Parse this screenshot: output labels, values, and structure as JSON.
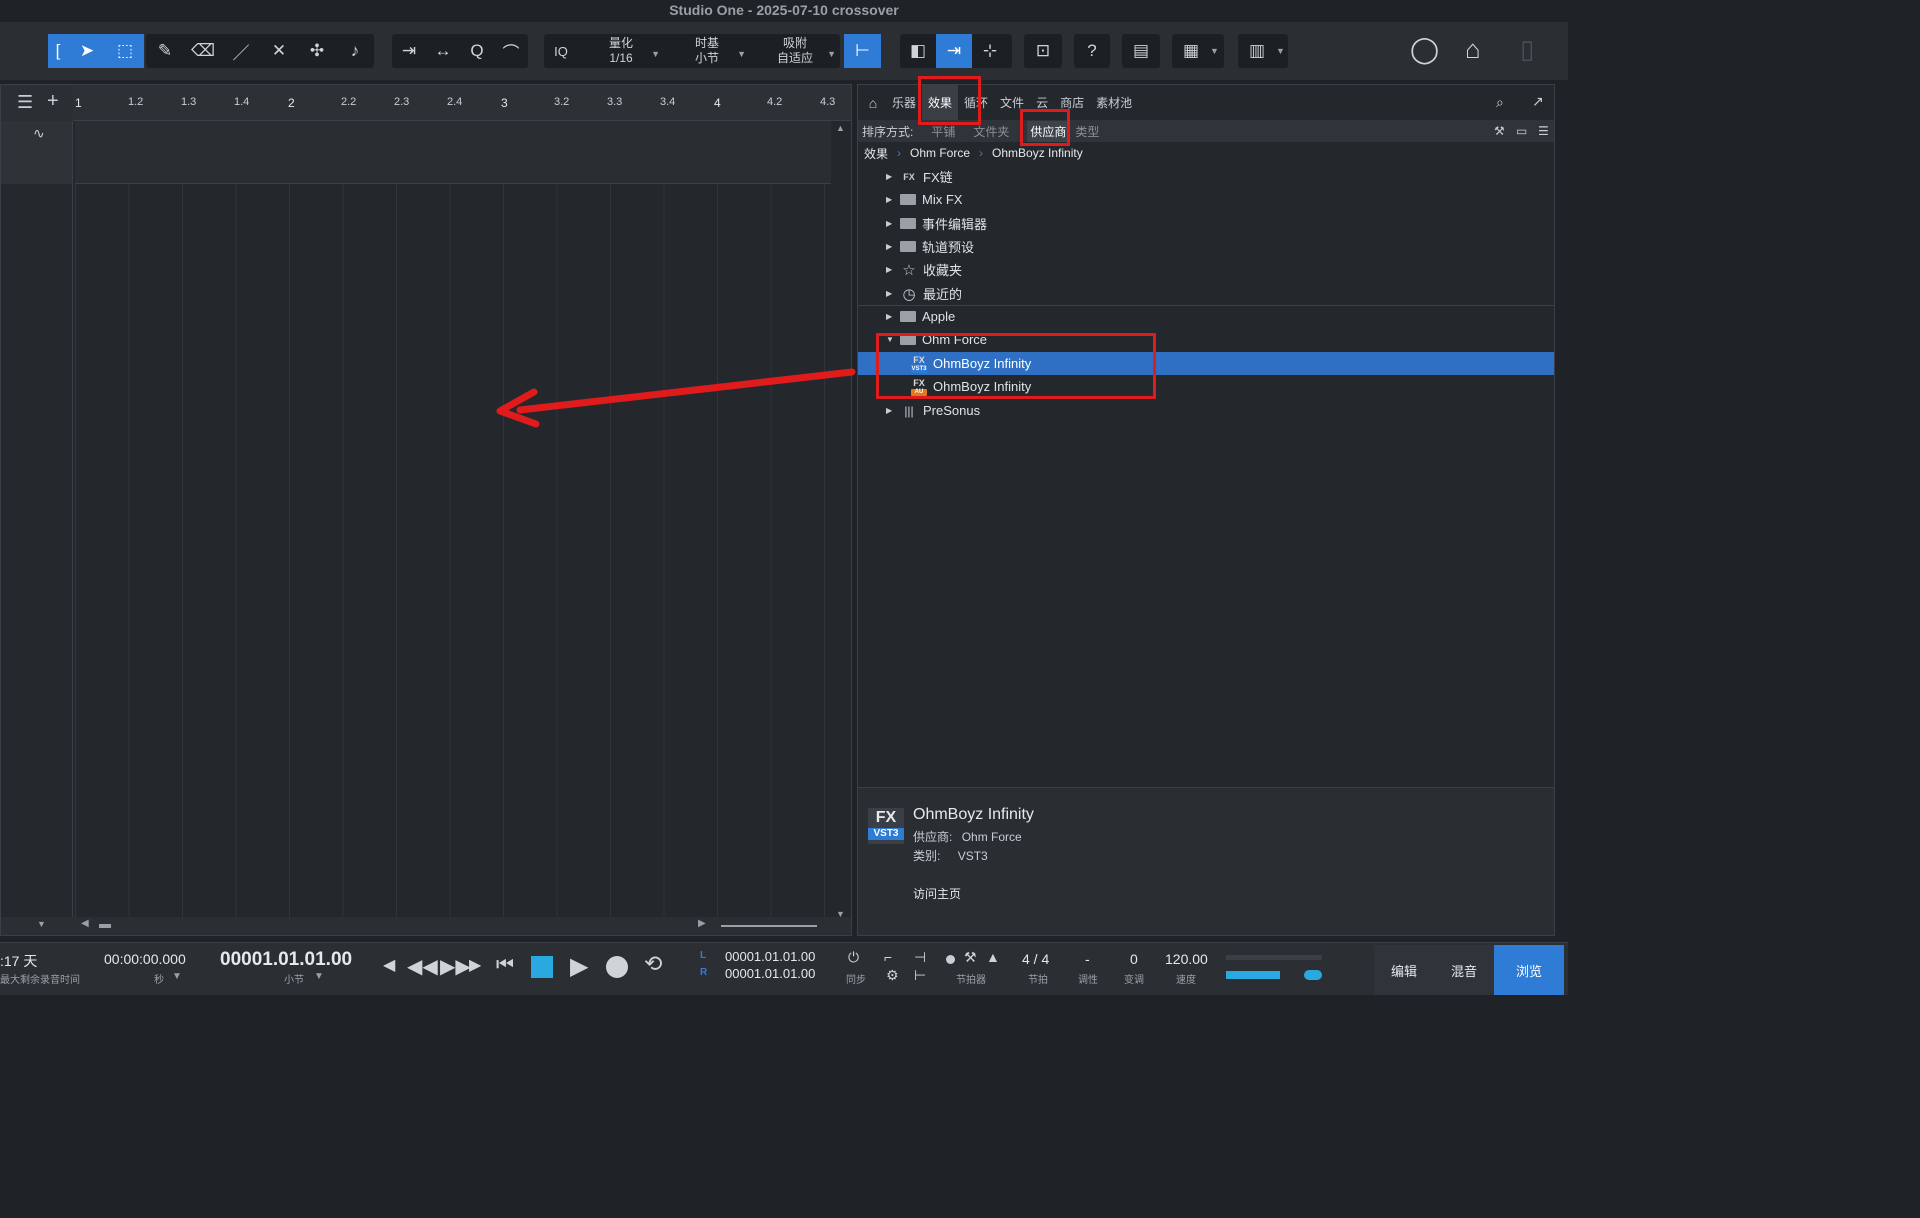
{
  "window": {
    "title": "Studio One - 2025-07-10 crossover"
  },
  "toolbar": {
    "quantize_label": "量化",
    "quantize_value": "1/16",
    "timebase_label": "时基",
    "timebase_value": "小节",
    "snap_label": "吸附",
    "snap_value": "自适应",
    "iq_label": "IQ",
    "help_label": "?"
  },
  "ruler": {
    "ticks": [
      "1",
      "1.2",
      "1.3",
      "1.4",
      "2",
      "2.2",
      "2.3",
      "2.4",
      "3",
      "3.2",
      "3.3",
      "3.4",
      "4",
      "4.2",
      "4.3"
    ]
  },
  "browser": {
    "tabs": [
      "乐器",
      "效果",
      "循环",
      "文件",
      "云",
      "商店",
      "素材池"
    ],
    "active_tab": "效果",
    "sort_label": "排序方式:",
    "sort_options": [
      "平铺",
      "文件夹",
      "供应商",
      "类型"
    ],
    "sort_selected": "供应商",
    "breadcrumb": [
      "效果",
      "Ohm Force",
      "OhmBoyz Infinity"
    ],
    "tree": [
      {
        "label": "FX链",
        "icon": "fx-chain-icon"
      },
      {
        "label": "Mix FX",
        "icon": "mixfx-icon"
      },
      {
        "label": "事件编辑器",
        "icon": "event-editor-icon"
      },
      {
        "label": "轨道预设",
        "icon": "track-preset-icon"
      },
      {
        "label": "收藏夹",
        "icon": "star-icon"
      },
      {
        "label": "最近的",
        "icon": "clock-icon"
      },
      {
        "label": "Apple",
        "icon": "folder-icon"
      },
      {
        "label": "Ohm Force",
        "icon": "folder-open-icon"
      },
      {
        "label": "OhmBoyz Infinity",
        "icon": "fx-vst3-icon",
        "badge": "VST3"
      },
      {
        "label": "OhmBoyz Infinity",
        "icon": "fx-au-icon",
        "badge": "AU"
      },
      {
        "label": "PreSonus",
        "icon": "presonus-icon"
      }
    ],
    "info": {
      "badge_top": "FX",
      "badge_bottom": "VST3",
      "name": "OhmBoyz Infinity",
      "vendor_label": "供应商:",
      "vendor": "Ohm Force",
      "category_label": "类别:",
      "category": "VST3",
      "homepage": "访问主页"
    }
  },
  "transport": {
    "record_time": ":17 天",
    "record_time_label": "最大剩余录音时间",
    "seconds_value": "00:00:00.000",
    "seconds_label": "秒",
    "position_value": "00001.01.01.00",
    "position_label": "小节",
    "loop_l_label": "L",
    "loop_r_label": "R",
    "loop_l": "00001.01.01.00",
    "loop_r": "00001.01.01.00",
    "sync_label": "同步",
    "metronome_label": "节拍器",
    "time_sig": "4 / 4",
    "time_sig_label": "节拍",
    "key": "-",
    "key_label": "调性",
    "transpose": "0",
    "transpose_label": "变调",
    "tempo": "120.00",
    "tempo_label": "速度"
  },
  "pages": {
    "edit": "编辑",
    "mix": "混音",
    "browse": "浏览"
  },
  "colors": {
    "accent": "#2f7cd6",
    "annotation": "#e01b1b"
  }
}
